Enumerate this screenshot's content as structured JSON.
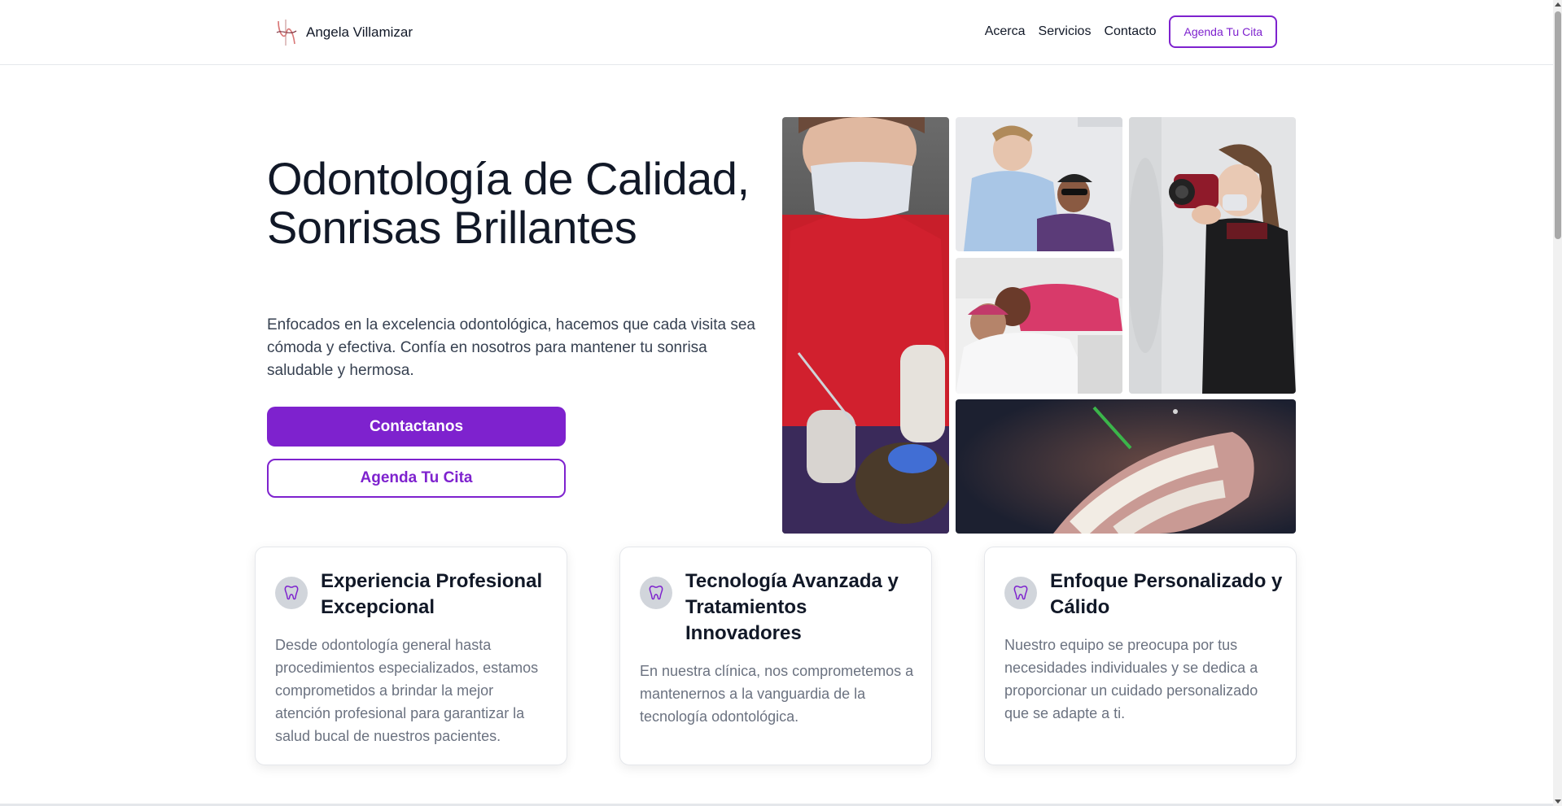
{
  "header": {
    "brand_name": "Angela Villamizar",
    "nav": [
      {
        "label": "Acerca"
      },
      {
        "label": "Servicios"
      },
      {
        "label": "Contacto"
      }
    ],
    "cta_label": "Agenda Tu Cita"
  },
  "hero": {
    "title": "Odontología de Calidad, Sonrisas Brillantes",
    "subtitle": "Enfocados en la excelencia odontológica, hacemos que cada visita sea cómoda y efectiva. Confía en nosotros para mantener tu sonrisa saludable y hermosa.",
    "primary_button": "Contactanos",
    "secondary_button": "Agenda Tu Cita"
  },
  "gallery": [
    {
      "icon": "dentist-treating-patient-photo"
    },
    {
      "icon": "dentist-with-patient-photo"
    },
    {
      "icon": "woman-with-camera-photo"
    },
    {
      "icon": "child-patient-photo"
    },
    {
      "icon": "teeth-closeup-photo"
    }
  ],
  "features": [
    {
      "icon": "tooth-icon",
      "title": "Experiencia Profesional Excepcional",
      "text": "Desde odontología general hasta procedimientos especializados, estamos comprometidos a brindar la mejor atención profesional para garantizar la salud bucal de nuestros pacientes."
    },
    {
      "icon": "tooth-icon",
      "title": "Tecnología Avanzada y Tratamientos Innovadores",
      "text": "En nuestra clínica, nos comprometemos a mantenernos a la vanguardia de la tecnología odontológica."
    },
    {
      "icon": "tooth-icon",
      "title": "Enfoque Personalizado y Cálido",
      "text": "Nuestro equipo se preocupa por tus necesidades individuales y se dedica a proporcionar un cuidado personalizado que se adapte a ti."
    }
  ],
  "colors": {
    "accent": "#7e22ce",
    "text": "#111827",
    "muted": "#6b7280"
  }
}
